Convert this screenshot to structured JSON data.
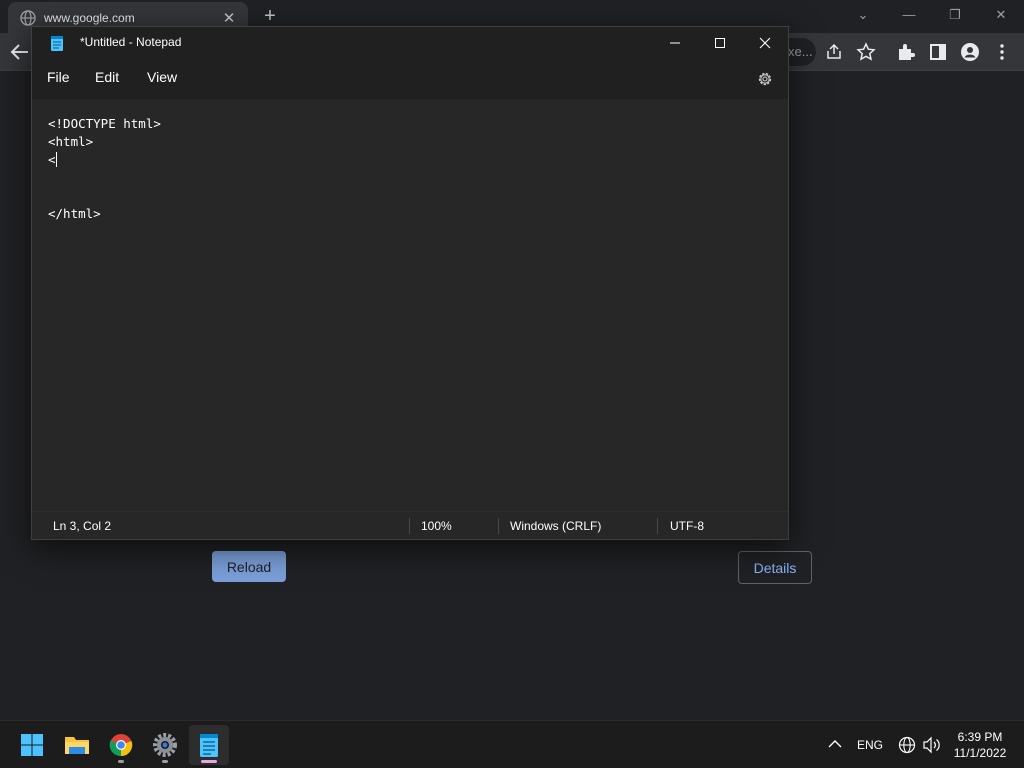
{
  "chrome": {
    "tab_title": "www.google.com",
    "tab_close": "✕",
    "new_tab": "+",
    "omnibox_tail": "xe...",
    "reload_label": "Reload",
    "details_label": "Details",
    "win_min": "—",
    "win_max": "❐",
    "win_close": "✕",
    "win_search": "⌄"
  },
  "notepad": {
    "title": "*Untitled - Notepad",
    "menu": [
      "File",
      "Edit",
      "View"
    ],
    "lines": [
      "<!DOCTYPE html>",
      "<html>",
      "<",
      "",
      "",
      "</html>"
    ],
    "status": {
      "position": "Ln 3, Col 2",
      "zoom": "100%",
      "line_ending": "Windows (CRLF)",
      "encoding": "UTF-8"
    }
  },
  "taskbar": {
    "apps": [
      "windows-start-icon",
      "file-explorer-icon",
      "chrome-icon",
      "settings-icon",
      "notepad-icon"
    ],
    "language": "ENG",
    "time": "6:39 PM",
    "date": "11/1/2022"
  },
  "colors": {
    "accent_blue": "#8ab4f8",
    "notepad_bg": "#272727",
    "titlebar_bg": "#202020",
    "chrome_bg": "#202124"
  }
}
